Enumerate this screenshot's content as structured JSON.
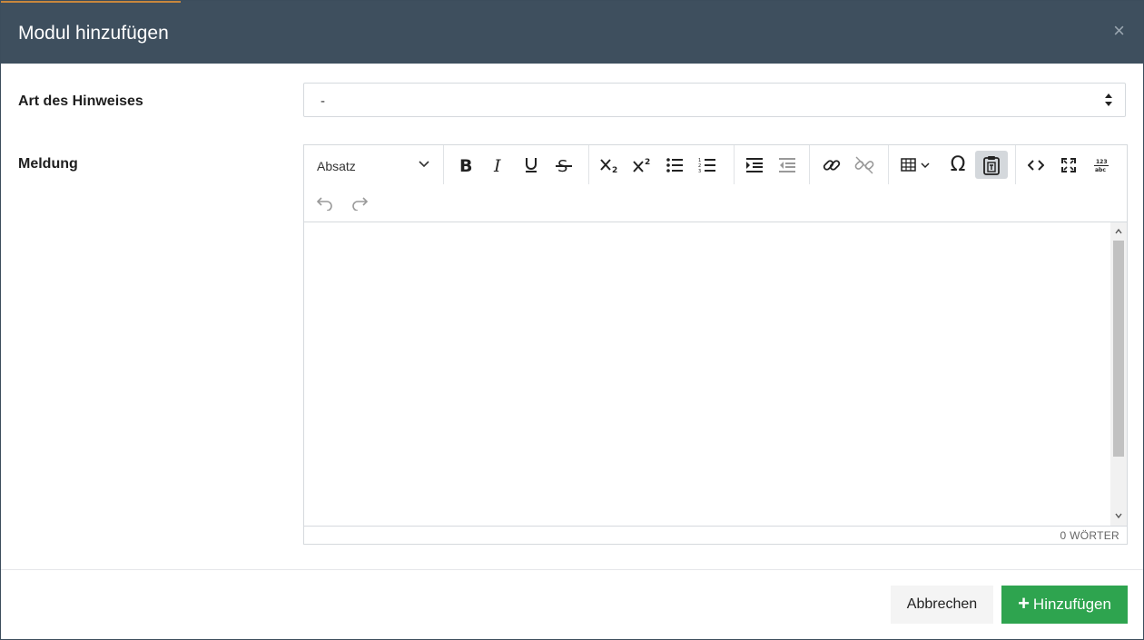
{
  "modal": {
    "title": "Modul hinzufügen",
    "close_glyph": "×"
  },
  "form": {
    "type_label": "Art des Hinweises",
    "type_value": "-",
    "message_label": "Meldung"
  },
  "editor": {
    "format_select": "Absatz",
    "toolbar_icons": [
      "bold-icon",
      "italic-icon",
      "underline-icon",
      "strikethrough-icon",
      "subscript-icon",
      "superscript-icon",
      "bullet-list-icon",
      "numbered-list-icon",
      "indent-icon",
      "outdent-icon",
      "link-icon",
      "unlink-icon",
      "table-icon",
      "special-char-icon",
      "paste-text-icon",
      "source-code-icon",
      "fullscreen-icon",
      "word-count-icon",
      "undo-icon",
      "redo-icon"
    ],
    "active_tool": "paste-text-icon",
    "word_count": "0 WÖRTER"
  },
  "footer": {
    "cancel_label": "Abbrechen",
    "add_label": "Hinzufügen"
  },
  "colors": {
    "header_bg": "#3e4f5e",
    "accent": "#c8873d",
    "primary_button": "#2ea44f"
  }
}
